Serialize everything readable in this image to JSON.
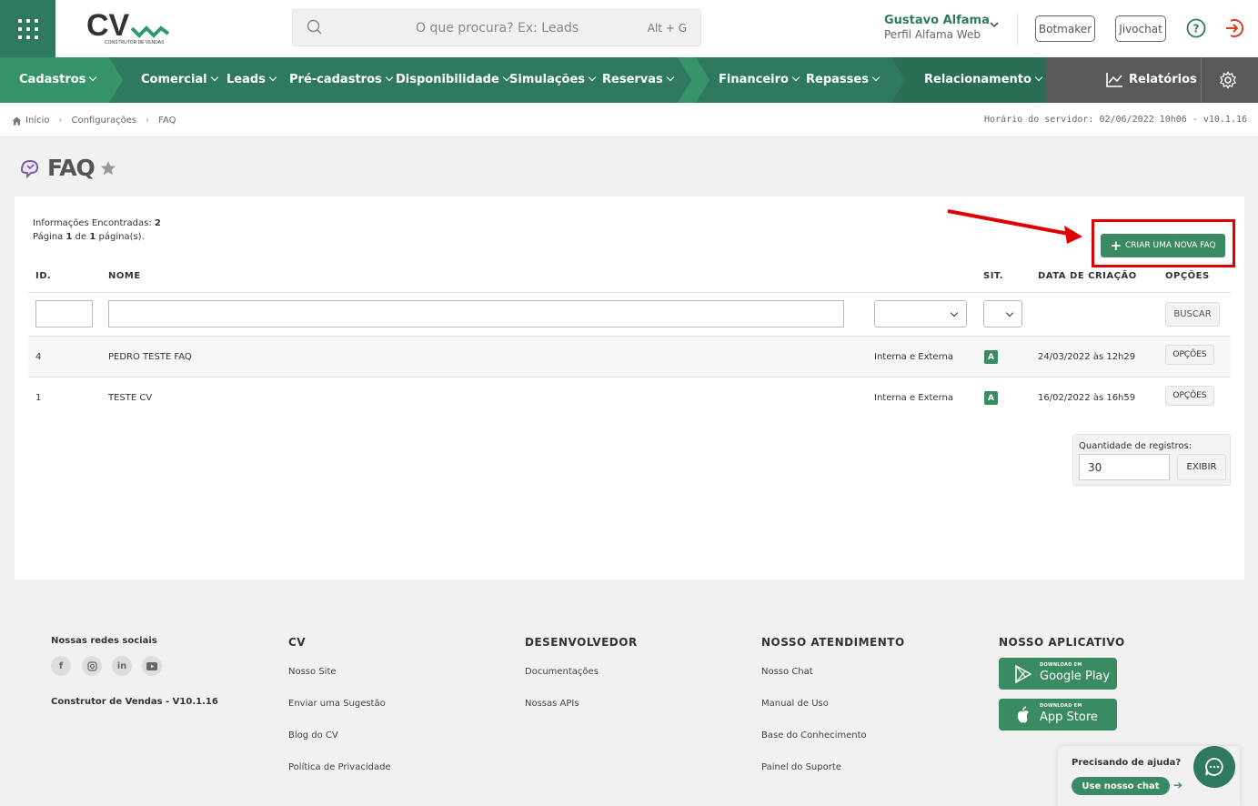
{
  "header": {
    "logo_text": "CV",
    "logo_subtitle": "CONSTRUTOR DE VENDAS",
    "search_placeholder": "O que procura? Ex: Leads",
    "search_shortcut": "Alt + G",
    "user_name": "Gustavo Alfama",
    "user_profile": "Perfil Alfama Web",
    "botmaker_label": "Botmaker",
    "jivochat_label": "Jivochat"
  },
  "nav": {
    "items": [
      "Cadastros",
      "Comercial",
      "Leads",
      "Pré-cadastros",
      "Disponibilidade",
      "Simulações",
      "Reservas",
      "Financeiro",
      "Repasses",
      "Relacionamento"
    ],
    "reports_label": "Relatórios"
  },
  "breadcrumb": [
    "Início",
    "Configurações",
    "FAQ"
  ],
  "server_time": "Horário do servidor: 02/06/2022 10h06 - v10.1.16",
  "page": {
    "title": "FAQ"
  },
  "info": {
    "found_label": "Informações Encontradas:",
    "found_count": "2",
    "page_w1": "Página",
    "page_current": "1",
    "page_w2": "de",
    "page_total": "1",
    "page_w3": "página(s)."
  },
  "create_button": "CRIAR UMA NOVA FAQ",
  "table": {
    "headers": {
      "id": "ID.",
      "name": "NOME",
      "sit": "SIT.",
      "date": "DATA DE CRIAÇÃO",
      "options": "OPÇÕES"
    },
    "search_button": "BUSCAR",
    "rows": [
      {
        "id": "4",
        "name": "PEDRO TESTE FAQ",
        "type": "Interna e Externa",
        "sit": "A",
        "date": "24/03/2022 às 12h29",
        "options": "OPÇÕES"
      },
      {
        "id": "1",
        "name": "TESTE CV",
        "type": "Interna e Externa",
        "sit": "A",
        "date": "16/02/2022 às 16h59",
        "options": "OPÇÕES"
      }
    ]
  },
  "records": {
    "label": "Quantidade de registros:",
    "value": "30",
    "button": "EXIBIR"
  },
  "footer": {
    "social_title": "Nossas redes sociais",
    "social_icons": [
      "facebook-icon",
      "instagram-icon",
      "linkedin-icon",
      "youtube-icon"
    ],
    "version": "Construtor de Vendas - V10.1.16",
    "cv": {
      "title": "CV",
      "links": [
        "Nosso Site",
        "Enviar uma Sugestão",
        "Blog do CV",
        "Política de Privacidade"
      ]
    },
    "dev": {
      "title": "DESENVOLVEDOR",
      "links": [
        "Documentações",
        "Nossas APIs"
      ]
    },
    "support": {
      "title": "NOSSO ATENDIMENTO",
      "links": [
        "Nosso Chat",
        "Manual de Uso",
        "Base do Conhecimento",
        "Painel do Suporte"
      ]
    },
    "app": {
      "title": "NOSSO APLICATIVO",
      "google_small": "DOWNLOAD EM",
      "google_large": "Google Play",
      "apple_small": "DOWNLOAD EM",
      "apple_large": "App Store"
    }
  },
  "help_widget": {
    "title": "Precisando de ajuda?",
    "button": "Use nosso chat"
  },
  "colors": {
    "primary": "#2f7a5e",
    "button": "#3a8a63",
    "highlight": "#e10000",
    "reports_bg": "#595959"
  }
}
